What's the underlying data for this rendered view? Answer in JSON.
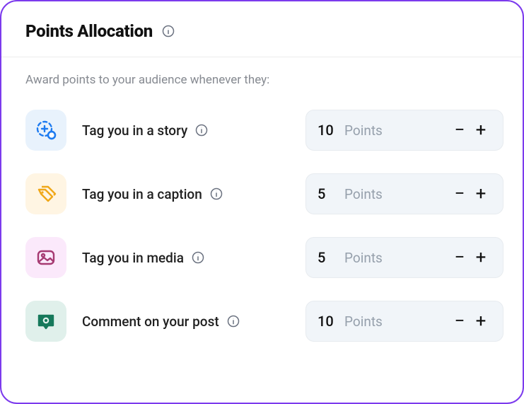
{
  "header": {
    "title": "Points Allocation"
  },
  "subhead": "Award points to your audience whenever they:",
  "unit_label": "Points",
  "rows": [
    {
      "label": "Tag you in a story",
      "value": "10"
    },
    {
      "label": "Tag you in a caption",
      "value": "5"
    },
    {
      "label": "Tag you in media",
      "value": "5"
    },
    {
      "label": "Comment on your post",
      "value": "10"
    }
  ]
}
